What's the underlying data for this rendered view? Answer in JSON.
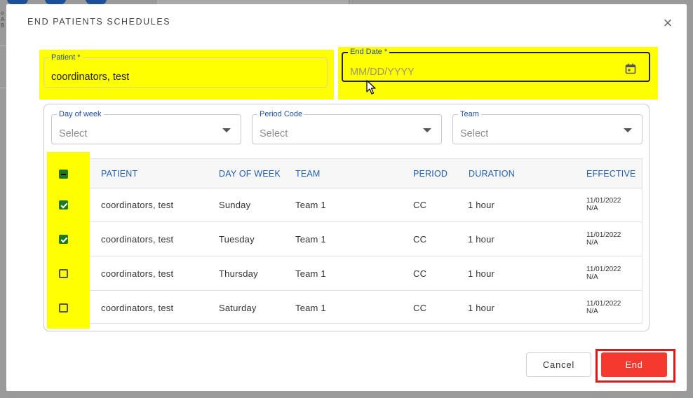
{
  "dialog": {
    "title": "END PATIENTS SCHEDULES",
    "close_glyph": "×"
  },
  "patient_field": {
    "label": "Patient *",
    "value": "coordinators, test"
  },
  "end_date_field": {
    "label": "End Date *",
    "placeholder": "MM/DD/YYYY",
    "icon": "calendar-icon"
  },
  "filters": [
    {
      "label": "Day of week",
      "placeholder": "Select"
    },
    {
      "label": "Period Code",
      "placeholder": "Select"
    },
    {
      "label": "Team",
      "placeholder": "Select"
    }
  ],
  "table": {
    "columns": [
      "PATIENT",
      "DAY OF WEEK",
      "TEAM",
      "PERIOD",
      "DURATION",
      "EFFECTIVE"
    ],
    "header_checkbox": "indeterminate",
    "rows": [
      {
        "checked": true,
        "patient": "coordinators, test",
        "day": "Sunday",
        "team": "Team 1",
        "period": "CC",
        "duration": "1 hour",
        "effective_start": "11/01/2022",
        "effective_end": "N/A"
      },
      {
        "checked": true,
        "patient": "coordinators, test",
        "day": "Tuesday",
        "team": "Team 1",
        "period": "CC",
        "duration": "1 hour",
        "effective_start": "11/01/2022",
        "effective_end": "N/A"
      },
      {
        "checked": false,
        "patient": "coordinators, test",
        "day": "Thursday",
        "team": "Team 1",
        "period": "CC",
        "duration": "1 hour",
        "effective_start": "11/01/2022",
        "effective_end": "N/A"
      },
      {
        "checked": false,
        "patient": "coordinators, test",
        "day": "Saturday",
        "team": "Team 1",
        "period": "CC",
        "duration": "1 hour",
        "effective_start": "11/01/2022",
        "effective_end": "N/A"
      }
    ]
  },
  "actions": {
    "cancel_label": "Cancel",
    "end_label": "End"
  },
  "colors": {
    "highlight": "#ffff00",
    "accent_blue": "#1e5fb4",
    "end_button": "#f43a2e",
    "check_green": "#1f7a1f",
    "callout_red": "#e01818"
  }
}
